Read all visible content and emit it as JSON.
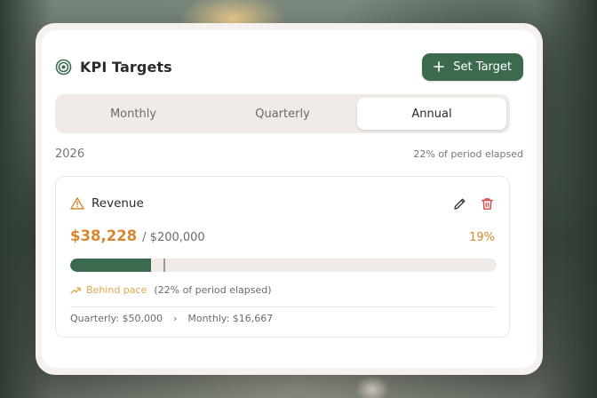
{
  "header": {
    "title": "KPI Targets",
    "title_icon": "target-icon",
    "set_target_label": "Set Target",
    "set_target_icon": "plus-icon"
  },
  "tabs": [
    {
      "label": "Monthly",
      "active": false
    },
    {
      "label": "Quarterly",
      "active": false
    },
    {
      "label": "Annual",
      "active": true
    }
  ],
  "period": {
    "year": "2026",
    "elapsed_text": "22% of period elapsed",
    "elapsed_fraction": 0.22
  },
  "kpi": {
    "name": "Revenue",
    "status_icon": "warning-triangle-icon",
    "current_value": "$38,228",
    "target_value": "/ $200,000",
    "percent_label": "19%",
    "progress_fraction": 0.19,
    "pace_status": "Behind pace",
    "pace_note": "(22% of period elapsed)",
    "quarterly_label": "Quarterly: $50,000",
    "chevron": "›",
    "monthly_label": "Monthly: $16,667"
  },
  "colors": {
    "accent_green": "#3c6a4f",
    "warning_orange": "#d5882f",
    "delete_red": "#d64a4a",
    "pace_amber": "#e0a74a"
  }
}
